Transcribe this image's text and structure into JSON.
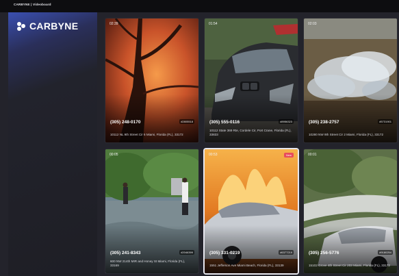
{
  "window": {
    "title": "CARBYNE | Videoboard"
  },
  "brand": {
    "name": "CARBYNE"
  },
  "colors": {
    "background": "#23232b",
    "badge": "#e84b5c",
    "sidebar_accent": "#3a4fb0"
  },
  "cards": [
    {
      "duration": "02:39",
      "phone": "(305) 248-0170",
      "id": "#2805518",
      "address": "10112 NL 9th Street Cir 6 Miami, Florida (FL), 33172",
      "badge": ""
    },
    {
      "duration": "01:54",
      "phone": "(305) 555-0116",
      "id": "#8956323",
      "address": "10112 State 369 Rte, Cordele Cir, Port Crane, Florida (FL), 33833",
      "badge": ""
    },
    {
      "duration": "02:03",
      "phone": "(305) 238-2757",
      "id": "#5731901",
      "address": "10280 NW 9th Street Cir 2 Miami, Florida (FL), 33172",
      "badge": ""
    },
    {
      "duration": "00:05",
      "phone": "(305) 241-8343",
      "id": "#2046399",
      "address": "600 NW 214th MIR and Honey St Miami, Florida (FL), 33169",
      "badge": ""
    },
    {
      "duration": "00:53",
      "phone": "(305) 331-0219",
      "id": "#6377219",
      "address": "1551 Jefferson Ave Miami Beach, Florida (FL), 33139",
      "badge": "New"
    },
    {
      "duration": "00:01",
      "phone": "(305) 256-5776",
      "id": "#9180254",
      "address": "15102 Grove 4th Street Cir 203 Miami, Florida (FL), 33172",
      "badge": ""
    }
  ]
}
